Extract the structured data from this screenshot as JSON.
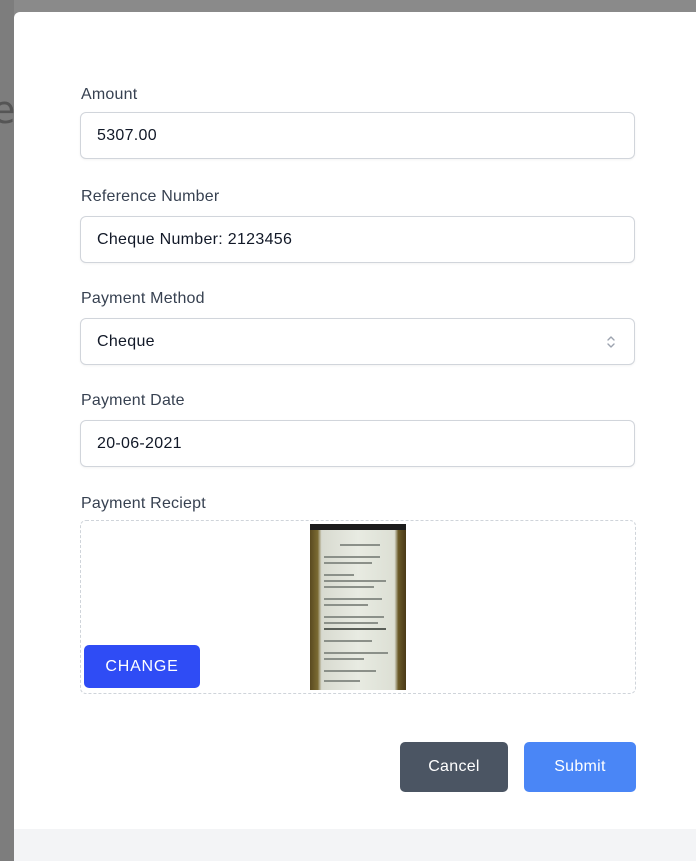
{
  "form": {
    "amount": {
      "label": "Amount",
      "value": "5307.00"
    },
    "reference": {
      "label": "Reference Number",
      "value": "Cheque Number: 2123456"
    },
    "payment_method": {
      "label": "Payment Method",
      "value": "Cheque"
    },
    "payment_date": {
      "label": "Payment Date",
      "value": "20-06-2021"
    },
    "receipt": {
      "label": "Payment Reciept",
      "change_label": "CHANGE"
    }
  },
  "actions": {
    "cancel_label": "Cancel",
    "submit_label": "Submit"
  },
  "colors": {
    "change_button": "#2f4cf5",
    "cancel_button": "#4b5563",
    "submit_button": "#4a86f6"
  },
  "icons": {
    "select_arrows": "chevron-up-down-icon"
  }
}
